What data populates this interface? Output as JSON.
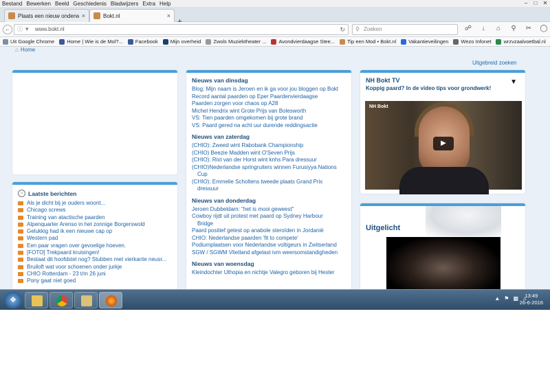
{
  "menubar": {
    "items": [
      "Bestand",
      "Bewerken",
      "Beeld",
      "Geschiedenis",
      "Bladwijzers",
      "Extra",
      "Help"
    ]
  },
  "tabs": [
    {
      "label": "Plaats een nieuw onderwer...",
      "close": "×",
      "active": false
    },
    {
      "label": "Bokt.nl",
      "close": "×",
      "active": true
    }
  ],
  "newtab": "+",
  "nav": {
    "url": "www.bokt.nl",
    "search_placeholder": "Zoeken"
  },
  "bookmarks": [
    "Uit Google Chrome",
    "Home | Wie is de Mol?...",
    "Facebook",
    "Mijn overheid",
    "Zwols Muziektheater ...",
    "Avondvierdaagse Stee...",
    "Tip een Mod • Bokt.nl",
    "Vakantieveilingen",
    "Wezo Infonet",
    "wrzvzaalvoetbal.nl"
  ],
  "page": {
    "home": "Home",
    "search_link": "Uitgebreid zoeken",
    "news": [
      {
        "day": "Nieuws van dinsdag",
        "items": [
          "Blog: Mijn naam is Jeroen en ik ga voor jou bloggen op Bokt",
          "Record aantal paarden op Eper Paardenvierdaagse",
          "Paarden zorgen voor chaos op A28",
          "Michel Hendrix wint Grote Prijs van Bolesworth",
          "VS: Tien paarden omgekomen bij grote brand",
          "VS: Paard gered na acht uur durende reddingsactie"
        ]
      },
      {
        "day": "Nieuws van zaterdag",
        "items": [
          "(CHIO): Zweed wint Rabobank Championship",
          "(CHIO) Beezie Madden wint O'Seven Prijs",
          "(CHIO): Rixt van der Horst wint knhs Para dressuur",
          "(CHIO)Nederlandse springruiters winnen Furusiyya Nations",
          "Cup",
          "(CHIO): Emmelie Scholtens tweede plaats Grand Prix",
          "dressuur"
        ]
      },
      {
        "day": "Nieuws van donderdag",
        "items": [
          "Jeroen Dubbeldam: \"het is mooi geweest\"",
          "Cowboy rijdt uit protest met paard op Sydney Harbour",
          "Bridge",
          "Paard positief getest op anabole steroïden in Jordanië",
          "CHIO: Nederlandse paarden 'fit to compete'",
          "Podiumplaatsen voor Nederlandse voltigeurs in Zwitserland",
          "SGW / SGWM Vlietland afgelast ivm weersomstandigheden"
        ]
      },
      {
        "day": "Nieuws van woensdag",
        "items": [
          "Kleindochter Uthopia en nichtje Valegro geboren bij Hester"
        ]
      }
    ],
    "latest": {
      "title": "Laatste berichten",
      "items": [
        "Als je dicht bij je ouders woont...",
        "Chicago screws",
        "Training van atactische paarden",
        "Alpenquarter Arenso in het zonnige Borgerswold",
        "Gelukkig had ik een nieuwe cap op",
        "Western pad",
        "Een paar vragen over gevoelige hoeven.",
        "[FOTO] Trekpaard kruisingen!",
        "Bestaat dit hoofdstel nog? Stubben met vierkante neusr...",
        "Bruiloft wat voor schoenen onder jurkje",
        "CHIO Rotterdam - 23 t/m 26 juni",
        "Pony gaat niet goed"
      ]
    },
    "tv": {
      "title": "NH Bokt TV",
      "arrow": "▼",
      "subtitle": "Koppig paard? In de video tips voor grondwerk!",
      "logo": "NH Bokt"
    },
    "featured": {
      "title": "Uitgelicht"
    }
  },
  "taskbar": {
    "clock_time": "13:49",
    "clock_date": "26-6-2016"
  },
  "colors": {
    "accent": "#4a9fd8",
    "link": "#1f62a5",
    "bullet": "#e6892a"
  }
}
